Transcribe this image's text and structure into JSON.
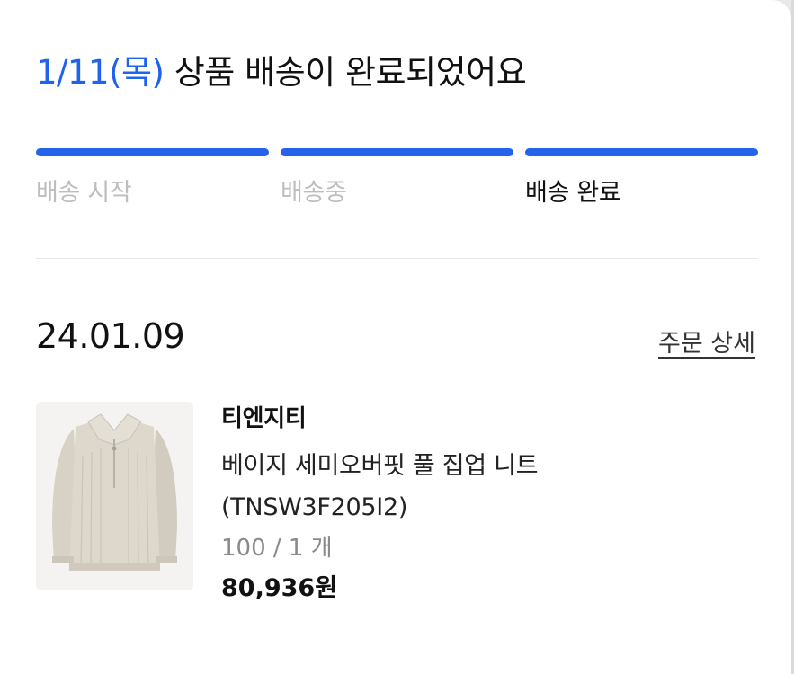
{
  "headline": {
    "date": "1/11(목)",
    "message": "상품 배송이 완료되었어요"
  },
  "progress": {
    "accent_color": "#2563eb",
    "steps": [
      {
        "label": "배송 시작",
        "active": false
      },
      {
        "label": "배송중",
        "active": false
      },
      {
        "label": "배송 완료",
        "active": true
      }
    ]
  },
  "order": {
    "date": "24.01.09",
    "detail_link": "주문 상세",
    "item": {
      "image_icon": "beige-half-zip-knit-sweater",
      "brand": "티엔지티",
      "name_line1": "베이지 세미오버핏 풀 집업 니트",
      "name_line2": "(TNSW3F205I2)",
      "option": "100 / 1 개",
      "price": "80,936원"
    }
  }
}
